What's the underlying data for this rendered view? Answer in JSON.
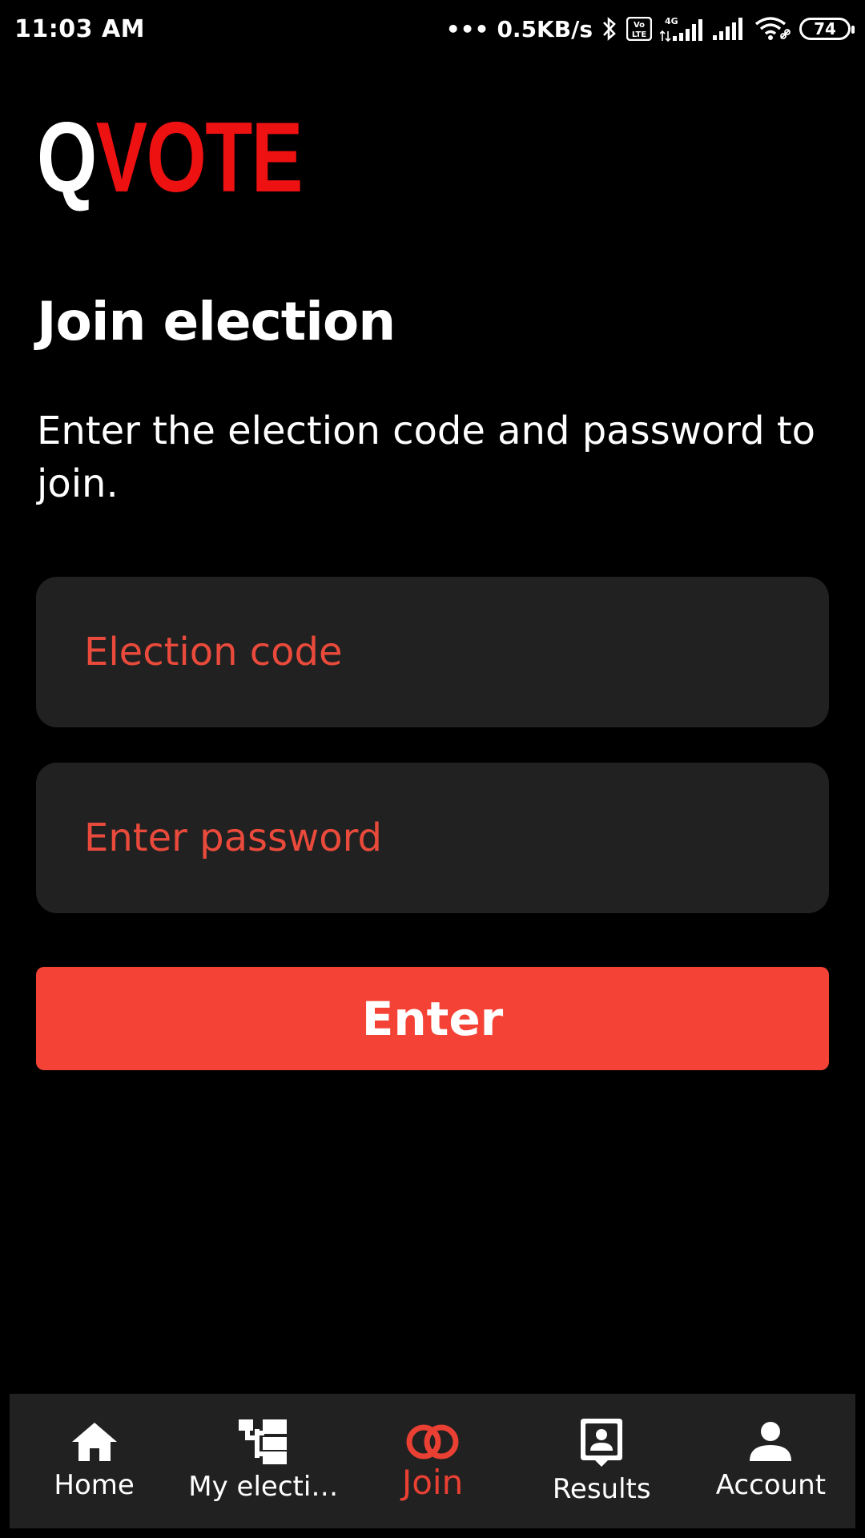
{
  "status_bar": {
    "time": "11:03 AM",
    "network_speed": "0.5KB/s",
    "volte": "Vo LTE",
    "network_type": "4G",
    "battery": "74"
  },
  "logo": {
    "first_letter": "Q",
    "rest": "VOTE"
  },
  "page": {
    "title": "Join election",
    "subtitle": "Enter the election code and password to join."
  },
  "form": {
    "code_placeholder": "Election code",
    "password_placeholder": "Enter password",
    "enter_label": "Enter"
  },
  "nav": {
    "items": [
      {
        "label": "Home",
        "icon": "home-icon"
      },
      {
        "label": "My electi…",
        "icon": "elections-icon"
      },
      {
        "label": "Join",
        "icon": "join-icon",
        "active": true
      },
      {
        "label": "Results",
        "icon": "results-icon"
      },
      {
        "label": "Account",
        "icon": "account-icon"
      }
    ],
    "active_color": "#e94033"
  },
  "colors": {
    "background": "#000000",
    "accent": "#f44336",
    "logo_red": "#ee1111",
    "field_bg": "#212121",
    "placeholder": "#ea4a3b"
  }
}
